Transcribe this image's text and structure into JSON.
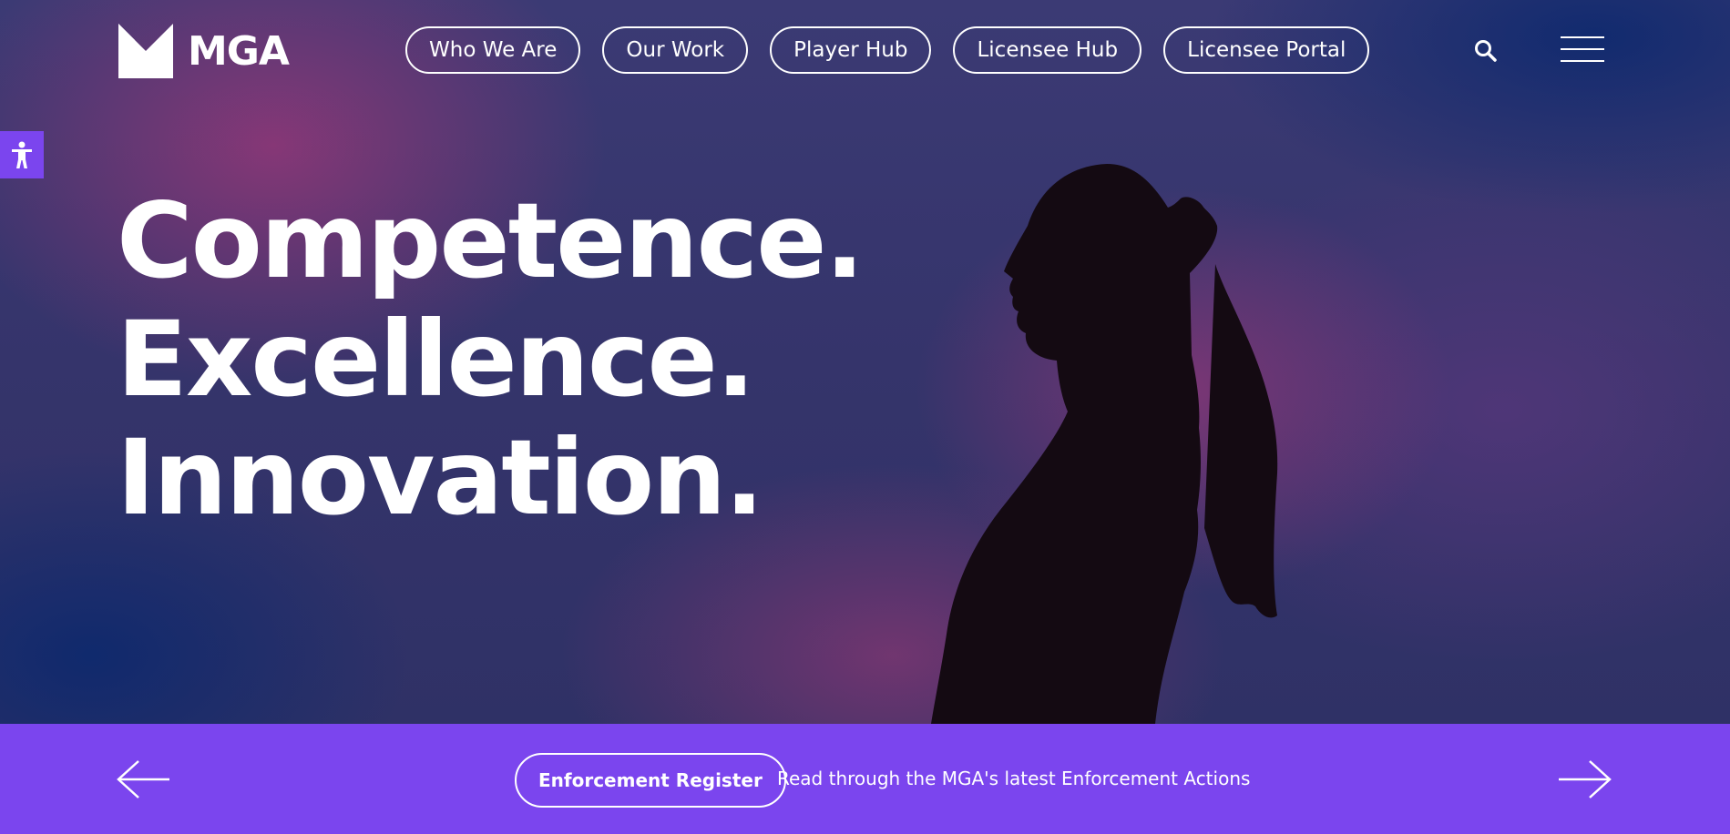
{
  "header": {
    "logo_text": "MGA",
    "nav": [
      {
        "label": "Who We Are"
      },
      {
        "label": "Our Work"
      },
      {
        "label": "Player Hub"
      },
      {
        "label": "Licensee Hub"
      },
      {
        "label": "Licensee Portal"
      }
    ],
    "search_icon": "search-icon",
    "menu_icon": "hamburger-menu-icon"
  },
  "accessibility": {
    "icon": "accessibility-person-icon",
    "color": "#7b45ee"
  },
  "hero": {
    "lines": [
      "Competence.",
      "Excellence.",
      "Innovation."
    ]
  },
  "banner": {
    "button_label": "Enforcement Register",
    "description": "Read through the MGA's latest Enforcement Actions",
    "prev_icon": "arrow-left-icon",
    "next_icon": "arrow-right-icon",
    "background": "#7b45ee"
  }
}
